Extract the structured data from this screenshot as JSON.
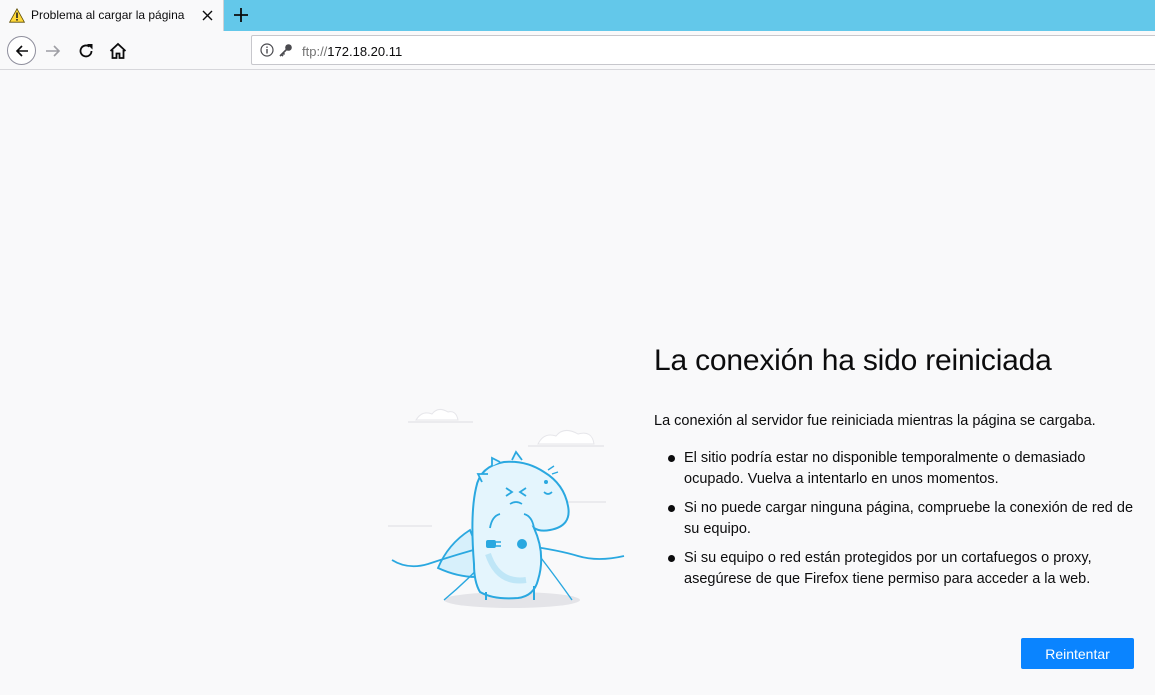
{
  "tab": {
    "title": "Problema al cargar la página",
    "icon": "warning-icon"
  },
  "nav": {
    "back_icon": "back-arrow-icon",
    "forward_icon": "forward-arrow-icon",
    "reload_icon": "reload-icon",
    "home_icon": "home-icon"
  },
  "urlbar": {
    "scheme": "ftp://",
    "host": "172.18.20.11",
    "info_icon": "info-icon",
    "key_icon": "key-icon"
  },
  "error": {
    "title": "La conexión ha sido reiniciada",
    "intro": "La conexión al servidor fue reiniciada mientras la página se cargaba.",
    "items": [
      "El sitio podría estar no disponible temporalmente o demasiado ocupado. Vuelva a intentarlo en unos momentos.",
      "Si no puede cargar ninguna página, compruebe la conexión de red de su equipo.",
      "Si su equipo o red están protegidos por un cortafuegos o proxy, asegúrese de que Firefox tiene permiso para acceder a la web."
    ],
    "retry_label": "Reintentar"
  },
  "colors": {
    "tabstrip": "#63c8ea",
    "accent": "#0a84ff",
    "illustration": "#2aa8e0"
  }
}
